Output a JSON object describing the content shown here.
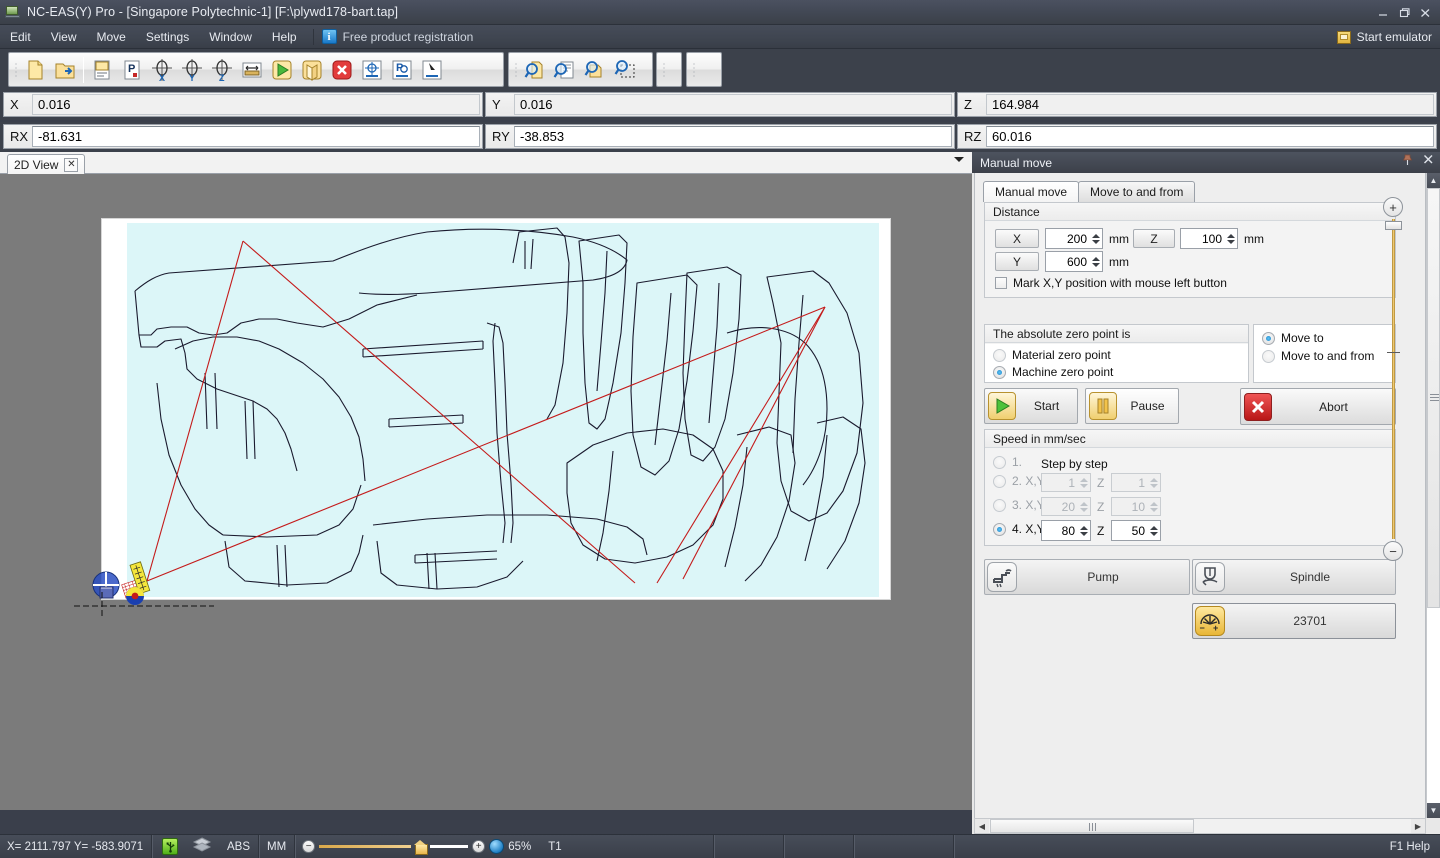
{
  "window": {
    "title": "NC-EAS(Y) Pro - [Singapore Polytechnic-1] [F:\\plywd178-bart.tap]",
    "icon": "app-monitor-icon",
    "minimize": "–",
    "maximize": "❐",
    "close": "✕"
  },
  "menu": {
    "items": [
      "Edit",
      "View",
      "Move",
      "Settings",
      "Window",
      "Help"
    ],
    "registration_label": "Free product registration",
    "registration_icon": "info-icon",
    "start_emulator_label": "Start emulator",
    "start_emulator_icon": "emulator-icon"
  },
  "toolbar": {
    "group1": [
      {
        "name": "new-file-icon",
        "title": "New"
      },
      {
        "name": "open-file-icon",
        "title": "Open"
      },
      {
        "name": "separator",
        "title": ""
      },
      {
        "name": "import-dxf-icon",
        "title": "Import"
      },
      {
        "name": "parameters-icon",
        "title": "Parameters"
      },
      {
        "name": "zero-x-icon",
        "title": "Zero X"
      },
      {
        "name": "zero-y-icon",
        "title": "Zero Y"
      },
      {
        "name": "zero-z-icon",
        "title": "Zero Z"
      },
      {
        "name": "measure-icon",
        "title": "Measure"
      },
      {
        "name": "run-icon",
        "title": "Run"
      },
      {
        "name": "simulate-icon",
        "title": "Simulate"
      },
      {
        "name": "stop-icon",
        "title": "Stop"
      },
      {
        "name": "reference-icon",
        "title": "Reference"
      },
      {
        "name": "park-icon",
        "title": "Park"
      },
      {
        "name": "tool-change-icon",
        "title": "Tool change"
      }
    ],
    "group2": [
      {
        "name": "zoom-page-icon",
        "title": "Zoom page"
      },
      {
        "name": "zoom-fit-icon",
        "title": "Zoom fit"
      },
      {
        "name": "zoom-object-icon",
        "title": "Zoom object"
      },
      {
        "name": "zoom-window-icon",
        "title": "Zoom window"
      }
    ]
  },
  "coordinates": {
    "row1": [
      {
        "label": "X",
        "value": "0.016",
        "editable": false
      },
      {
        "label": "Y",
        "value": "0.016",
        "editable": false
      },
      {
        "label": "Z",
        "value": "164.984",
        "editable": false
      }
    ],
    "row2": [
      {
        "label": "RX",
        "value": "-81.631",
        "editable": true
      },
      {
        "label": "RY",
        "value": "-38.853",
        "editable": true
      },
      {
        "label": "RZ",
        "value": "60.016",
        "editable": true
      }
    ]
  },
  "document_tabs": [
    {
      "label": "2D View",
      "close": "✕",
      "active": true
    }
  ],
  "canvas": {
    "background": "#7b7b7b",
    "sheet_color": "#dcf6f8",
    "paper_color": "#ffffff",
    "toolpath_color": "#c41b1b",
    "outline_color": "#1a1a2e",
    "origin_marker": "machine-zero-marker",
    "material_marker": "material-zero-marker"
  },
  "panel": {
    "title": "Manual move",
    "pin_icon": "pin-icon",
    "close_icon": "close-icon",
    "tabs": [
      {
        "label": "Manual move",
        "active": true
      },
      {
        "label": "Move to and from",
        "active": false
      }
    ],
    "distance": {
      "legend": "Distance",
      "x_button": "X",
      "x_value": "200",
      "x_unit": "mm",
      "z_button": "Z",
      "z_value": "100",
      "z_unit": "mm",
      "y_button": "Y",
      "y_value": "600",
      "y_unit": "mm",
      "mark_checkbox_label": "Mark X,Y position with mouse left button",
      "mark_checked": false
    },
    "zero_point": {
      "legend": "The absolute zero point is",
      "options": [
        {
          "label": "Material zero point",
          "selected": false
        },
        {
          "label": "Machine zero point",
          "selected": true
        }
      ]
    },
    "move_mode": {
      "options": [
        {
          "label": "Move to",
          "selected": true
        },
        {
          "label": "Move to and from",
          "selected": false
        }
      ]
    },
    "actions": [
      {
        "label": "Start",
        "icon": "play-icon"
      },
      {
        "label": "Pause",
        "icon": "pause-icon"
      },
      {
        "label": "Abort",
        "icon": "abort-icon"
      }
    ],
    "speed": {
      "legend": "Speed in mm/sec",
      "step_label": "Step by step",
      "z_label": "Z",
      "rows": [
        {
          "label": "1.",
          "selected": false,
          "xy": "",
          "z": "",
          "disabled": true,
          "show_fields": false
        },
        {
          "label": "2. X,Y",
          "selected": false,
          "xy": "1",
          "z": "1",
          "disabled": true,
          "show_fields": true
        },
        {
          "label": "3. X,Y",
          "selected": false,
          "xy": "20",
          "z": "10",
          "disabled": true,
          "show_fields": true
        },
        {
          "label": "4. X,Y",
          "selected": true,
          "xy": "80",
          "z": "50",
          "disabled": false,
          "show_fields": true
        }
      ]
    },
    "devices": [
      {
        "label": "Pump",
        "icon": "faucet-icon",
        "active": false
      },
      {
        "label": "Spindle",
        "icon": "spindle-icon",
        "active": false
      },
      {
        "label": "23701",
        "icon": "laser-power-icon",
        "active": true
      }
    ],
    "zoom_slider": {
      "plus": "+",
      "minus": "−"
    }
  },
  "statusbar": {
    "coordinates": "X= 2111.797 Y= -583.9071",
    "usb_icon": "usb-connected-icon",
    "layers_icon": "layers-icon",
    "mode": "ABS",
    "units": "MM",
    "zoom_minus": "−",
    "zoom_plus": "+",
    "zoom_home_icon": "home-marker-icon",
    "globe_icon": "globe-icon",
    "zoom_value": "65%",
    "tool": "T1",
    "help": "F1 Help"
  }
}
